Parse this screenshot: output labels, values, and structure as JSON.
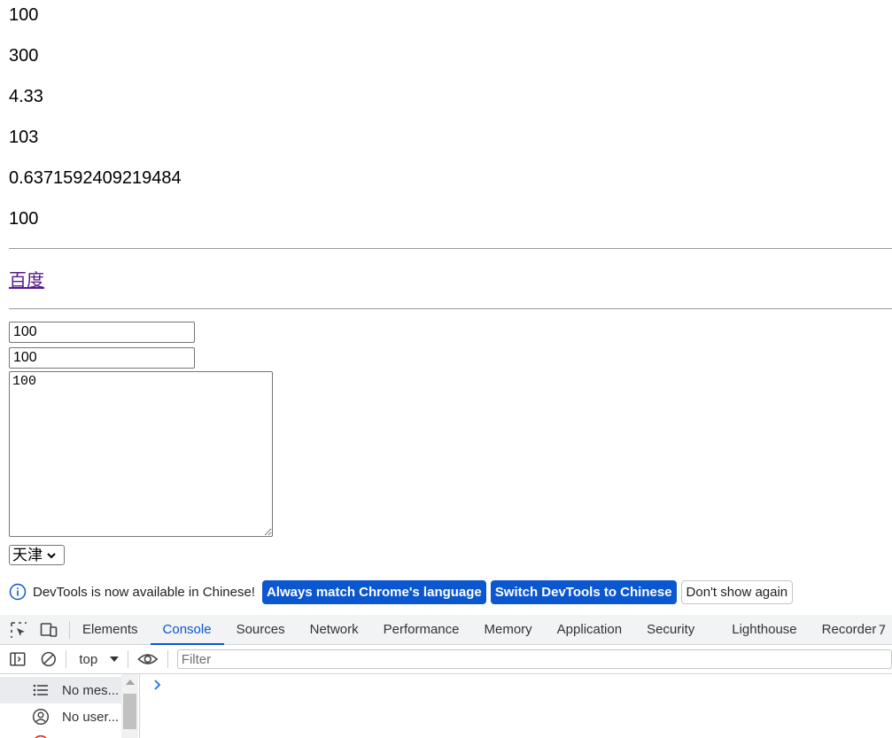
{
  "page": {
    "values": [
      "100",
      "300",
      "4.33",
      "103",
      "0.6371592409219484",
      "100"
    ],
    "link_text": "百度",
    "input1_value": "100",
    "input2_value": "100",
    "textarea_value": "100",
    "select_value": "天津"
  },
  "infobar": {
    "message": "DevTools is now available in Chinese!",
    "btn_match": "Always match Chrome's language",
    "btn_switch": "Switch DevTools to Chinese",
    "btn_dismiss": "Don't show again"
  },
  "tabs": [
    "Elements",
    "Console",
    "Sources",
    "Network",
    "Performance",
    "Memory",
    "Application",
    "Security",
    "Lighthouse",
    "Recorder"
  ],
  "active_tab": "Console",
  "console": {
    "context": "top",
    "filter_placeholder": "Filter"
  },
  "sidebar": {
    "items": [
      "No mes...",
      "No user..."
    ]
  },
  "colors": {
    "accent": "#0b57d0",
    "link_visited": "#551a8b"
  }
}
